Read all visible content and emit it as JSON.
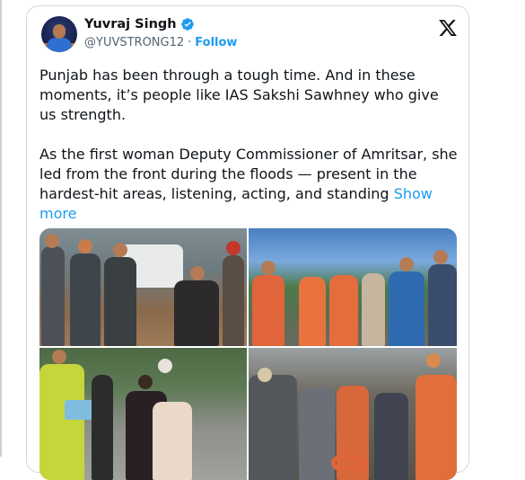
{
  "tweet": {
    "author_name": "Yuvraj Singh",
    "handle": "@YUVSTRONG12",
    "separator": "·",
    "follow_label": "Follow",
    "paragraph1": "Punjab has been through a tough time. And in these moments, it’s people like IAS Sakshi Sawhney who give us strength.",
    "paragraph2": "As the first woman Deputy Commissioner of Amritsar, she led from the front during the floods — present in the hardest-hit areas, listening, acting, and standing",
    "show_more_label": "Show more"
  },
  "icons": {
    "verified": "verified-badge-icon",
    "brand": "x-logo-icon"
  },
  "colors": {
    "accent": "#1d9bf0",
    "text": "#0f1419",
    "secondary": "#536471",
    "border": "#cfd9de"
  }
}
